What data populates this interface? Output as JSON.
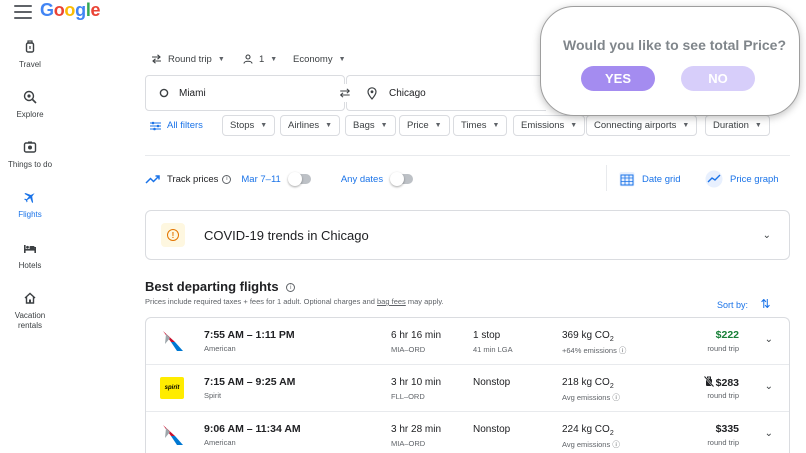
{
  "header": {
    "logo": "Google"
  },
  "nav": [
    {
      "label": "Travel",
      "icon": "travel-icon"
    },
    {
      "label": "Explore",
      "icon": "explore-icon"
    },
    {
      "label": "Things to do",
      "icon": "things-icon"
    },
    {
      "label": "Flights",
      "icon": "flight-icon",
      "active": true
    },
    {
      "label": "Hotels",
      "icon": "hotel-icon"
    },
    {
      "label": "Vacation rentals",
      "icon": "home-icon"
    }
  ],
  "search": {
    "trip_type": "Round trip",
    "passengers": "1",
    "cabin": "Economy",
    "origin": "Miami",
    "destination": "Chicago"
  },
  "filters": {
    "all_filters": "All filters",
    "chips": [
      "Stops",
      "Airlines",
      "Bags",
      "Price",
      "Times",
      "Emissions",
      "Connecting airports",
      "Duration"
    ]
  },
  "track": {
    "label": "Track prices",
    "dates": "Mar 7–11",
    "any_dates": "Any dates",
    "date_grid": "Date grid",
    "price_graph": "Price graph"
  },
  "covid": {
    "text": "COVID-19 trends in Chicago"
  },
  "results": {
    "title": "Best departing flights",
    "subtitle_pre": "Prices include required taxes + fees for 1 adult. Optional charges and ",
    "subtitle_link": "bag fees",
    "subtitle_post": " may apply.",
    "sort_by": "Sort by:",
    "flights": [
      {
        "times": "7:55 AM – 1:11 PM",
        "airline": "American",
        "duration": "6 hr 16 min",
        "route": "MIA–ORD",
        "stops": "1 stop",
        "stop_info": "41 min LGA",
        "co2": "369 kg CO",
        "emissions": "+64% emissions",
        "price": "$222",
        "price_type": "round trip",
        "logo": "american",
        "price_color": "#188038"
      },
      {
        "times": "7:15 AM – 9:25 AM",
        "airline": "Spirit",
        "duration": "3 hr 10 min",
        "route": "FLL–ORD",
        "stops": "Nonstop",
        "stop_info": "",
        "co2": "218 kg CO",
        "emissions": "Avg emissions",
        "price": "$283",
        "price_type": "round trip",
        "logo": "spirit",
        "spirit_text": "spirit"
      },
      {
        "times": "9:06 AM – 11:34 AM",
        "airline": "American",
        "duration": "3 hr 28 min",
        "route": "MIA–ORD",
        "stops": "Nonstop",
        "stop_info": "",
        "co2": "224 kg CO",
        "emissions": "Avg emissions",
        "price": "$335",
        "price_type": "round trip",
        "logo": "american"
      }
    ]
  },
  "popup": {
    "question": "Would you like to see total Price?",
    "yes": "YES",
    "no": "NO"
  },
  "colors": {
    "accent": "#1a73e8",
    "popup_yes": "#a48cf0",
    "popup_no": "#d7cefa"
  }
}
